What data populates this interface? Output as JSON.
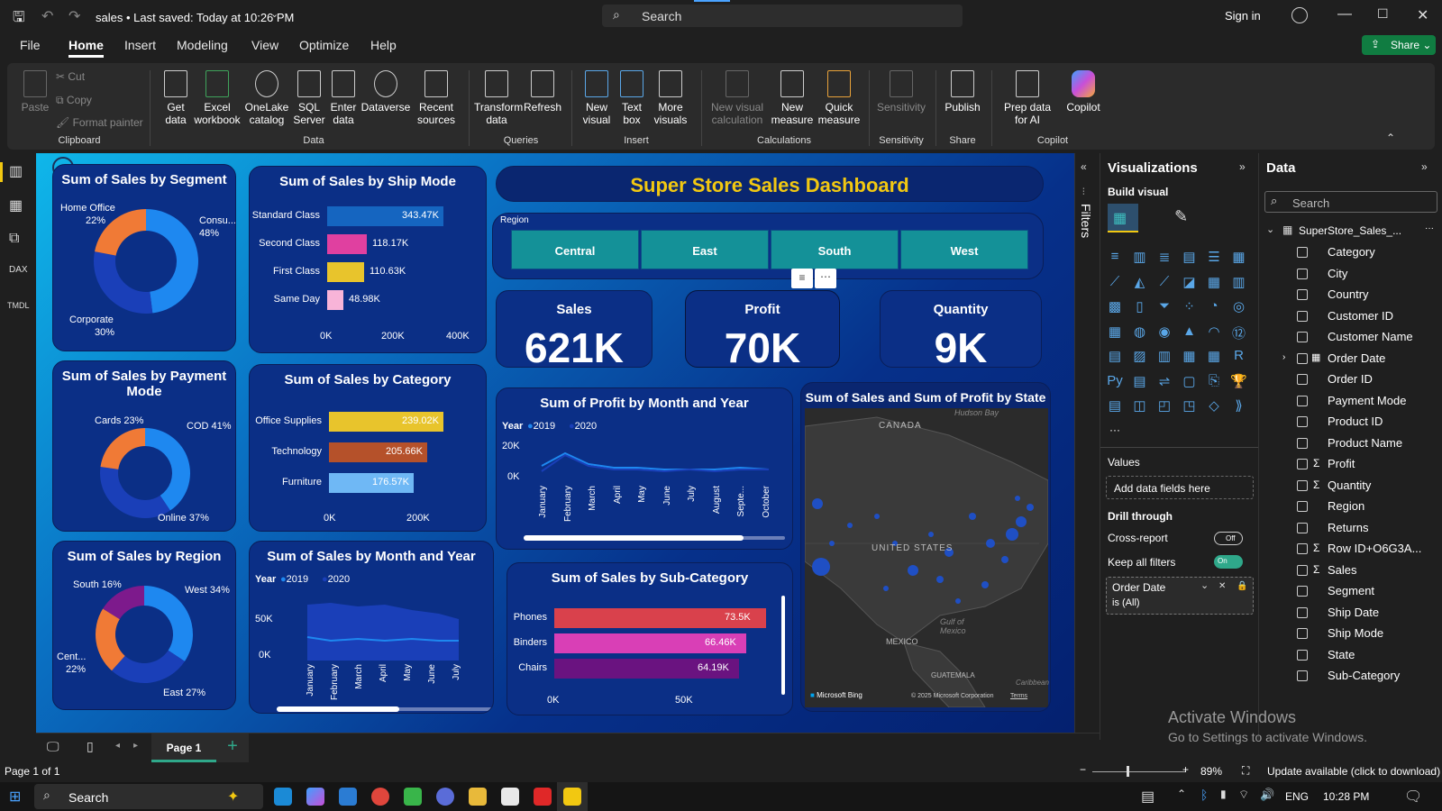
{
  "titlebar": {
    "title": "sales • Last saved: Today at 10:26 PM",
    "search": "Search",
    "signin": "Sign in"
  },
  "menu": [
    "File",
    "Home",
    "Insert",
    "Modeling",
    "View",
    "Optimize",
    "Help"
  ],
  "share": "Share",
  "ribbon": {
    "clipboard": {
      "paste": "Paste",
      "cut": "Cut",
      "copy": "Copy",
      "format_painter": "Format painter",
      "group": "Clipboard"
    },
    "data": {
      "get_data": "Get data",
      "excel": "Excel workbook",
      "onelake": "OneLake catalog",
      "sql": "SQL Server",
      "enter": "Enter data",
      "dataverse": "Dataverse",
      "recent": "Recent sources",
      "group": "Data"
    },
    "queries": {
      "transform": "Transform data",
      "refresh": "Refresh",
      "group": "Queries"
    },
    "insert": {
      "new_visual": "New visual",
      "text_box": "Text box",
      "more_visuals": "More visuals",
      "group": "Insert"
    },
    "calculations": {
      "new_visual_calc": "New visual calculation",
      "new_measure": "New measure",
      "quick_measure": "Quick measure",
      "group": "Calculations"
    },
    "sensitivity": {
      "label": "Sensitivity",
      "group": "Sensitivity"
    },
    "share": {
      "publish": "Publish",
      "group": "Share"
    },
    "copilot": {
      "prep": "Prep data for AI",
      "copilot": "Copilot",
      "group": "Copilot"
    }
  },
  "report": {
    "title": "Super Store Sales Dashboard",
    "segment": {
      "title": "Sum of Sales by Segment",
      "labels": [
        "Home Office",
        "22%",
        "Consu...",
        "48%",
        "Corporate",
        "30%"
      ]
    },
    "shipmode": {
      "title": "Sum of Sales by Ship Mode",
      "axis": [
        "0K",
        "200K",
        "400K"
      ]
    },
    "payment": {
      "title": "Sum of Sales by Payment Mode",
      "labels": [
        "Cards 23%",
        "COD 41%",
        "Online 37%"
      ]
    },
    "category": {
      "title": "Sum of Sales by Category",
      "axis": [
        "0K",
        "200K"
      ]
    },
    "region": {
      "title": "Sum of Sales by Region",
      "labels": [
        "South 16%",
        "West 34%",
        "Cent...",
        "22%",
        "East 27%"
      ]
    },
    "month_sales": {
      "title": "Sum of Sales by Month and Year",
      "year_label": "Year",
      "legend": [
        "2019",
        "2020"
      ],
      "y": [
        "50K",
        "0K"
      ],
      "months": [
        "January",
        "February",
        "March",
        "April",
        "May",
        "June",
        "July"
      ]
    },
    "slicer": {
      "label": "Region",
      "items": [
        "Central",
        "East",
        "South",
        "West"
      ]
    },
    "kpi": [
      {
        "title": "Sales",
        "value": "621K"
      },
      {
        "title": "Profit",
        "value": "70K"
      },
      {
        "title": "Quantity",
        "value": "9K"
      }
    ],
    "month_profit": {
      "title": "Sum of Profit by Month and Year",
      "year_label": "Year",
      "legend": [
        "2019",
        "2020"
      ],
      "y": [
        "20K",
        "0K"
      ],
      "months": [
        "January",
        "February",
        "March",
        "April",
        "May",
        "June",
        "July",
        "August",
        "Septe...",
        "October"
      ]
    },
    "subcat": {
      "title": "Sum of Sales by Sub-Category",
      "axis": [
        "0K",
        "50K"
      ]
    },
    "map": {
      "title": "Sum of Sales and Sum of Profit by State",
      "labels": [
        "CANADA",
        "Hudson Bay",
        "UNITED STATES",
        "Gulf of Mexico",
        "MEXICO",
        "GUATEMALA",
        "Caribbean"
      ],
      "credit": "Microsoft Bing",
      "copyright": "© 2025 Microsoft Corporation",
      "terms": "Terms"
    }
  },
  "chart_data": [
    {
      "type": "bar",
      "title": "Sum of Sales by Ship Mode",
      "categories": [
        "Standard Class",
        "Second Class",
        "First Class",
        "Same Day"
      ],
      "values": [
        343470,
        118170,
        110630,
        48980
      ],
      "labels": [
        "343.47K",
        "118.17K",
        "110.63K",
        "48.98K"
      ],
      "colors": [
        "#1565c0",
        "#e040a0",
        "#e8c42c",
        "#f8b4d8"
      ],
      "xlim": [
        0,
        400000
      ]
    },
    {
      "type": "bar",
      "title": "Sum of Sales by Category",
      "categories": [
        "Office Supplies",
        "Technology",
        "Furniture"
      ],
      "values": [
        239020,
        205660,
        176570
      ],
      "labels": [
        "239.02K",
        "205.66K",
        "176.57K"
      ],
      "colors": [
        "#e8c42c",
        "#b5512a",
        "#6fb8f5"
      ],
      "xlim": [
        0,
        260000
      ]
    },
    {
      "type": "bar",
      "title": "Sum of Sales by Sub-Category",
      "categories": [
        "Phones",
        "Binders",
        "Chairs"
      ],
      "values": [
        73500,
        66460,
        64190
      ],
      "labels": [
        "73.5K",
        "66.46K",
        "64.19K"
      ],
      "colors": [
        "#d9414c",
        "#d93fb6",
        "#6a1380"
      ],
      "xlim": [
        0,
        80000
      ]
    },
    {
      "type": "pie",
      "title": "Sum of Sales by Segment",
      "categories": [
        "Consumer",
        "Corporate",
        "Home Office"
      ],
      "values": [
        48,
        30,
        22
      ],
      "colors": [
        "#1e88f0",
        "#1a3fb8",
        "#f07a36"
      ]
    },
    {
      "type": "pie",
      "title": "Sum of Sales by Payment Mode",
      "categories": [
        "COD",
        "Online",
        "Cards"
      ],
      "values": [
        41,
        37,
        23
      ],
      "colors": [
        "#1e88f0",
        "#1a3fb8",
        "#f07a36"
      ]
    },
    {
      "type": "pie",
      "title": "Sum of Sales by Region",
      "categories": [
        "West",
        "East",
        "Central",
        "South"
      ],
      "values": [
        34,
        27,
        22,
        16
      ],
      "colors": [
        "#1e88f0",
        "#1a3fb8",
        "#f07a36",
        "#7d1a8c"
      ]
    }
  ],
  "panes": {
    "filters": "Filters",
    "visualizations": {
      "title": "Visualizations",
      "build": "Build visual",
      "values": "Values",
      "add_fields": "Add data fields here",
      "drill": "Drill through",
      "cross": "Cross-report",
      "cross_state": "Off",
      "keep": "Keep all filters",
      "keep_state": "On",
      "filter_field": "Order Date",
      "filter_value": "is (All)"
    },
    "data": {
      "title": "Data",
      "search": "Search",
      "table": "SuperStore_Sales_...",
      "fields": [
        "Category",
        "City",
        "Country",
        "Customer ID",
        "Customer Name",
        "Order Date",
        "Order ID",
        "Payment Mode",
        "Product ID",
        "Product Name",
        "Profit",
        "Quantity",
        "Region",
        "Returns",
        "Row ID+O6G3A...",
        "Sales",
        "Segment",
        "Ship Date",
        "Ship Mode",
        "State",
        "Sub-Category"
      ]
    }
  },
  "pagebar": {
    "page": "Page 1"
  },
  "status": {
    "page": "Page 1 of 1",
    "zoom": "89%",
    "update": "Update available (click to download)"
  },
  "taskbar": {
    "search": "Search",
    "lang": "ENG",
    "time": "10:28 PM"
  },
  "watermark": {
    "line1": "Activate Windows",
    "line2": "Go to Settings to activate Windows."
  }
}
